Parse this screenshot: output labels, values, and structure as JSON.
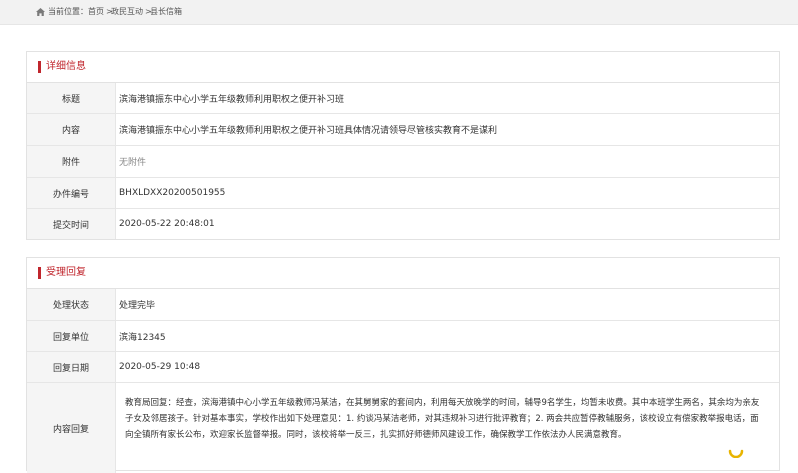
{
  "breadcrumb": {
    "prefix": "当前位置：",
    "items": [
      "首页",
      "政民互动",
      "县长信箱"
    ],
    "separator": ">"
  },
  "details": {
    "title": "详细信息",
    "rows": [
      {
        "label": "标题",
        "value": "滨海港镇振东中心小学五年级教师利用职权之便开补习班"
      },
      {
        "label": "内容",
        "value": "滨海港镇振东中心小学五年级教师利用职权之便开补习班具体情况请领导尽管核实教育不是谋利"
      },
      {
        "label": "附件",
        "value": "无附件"
      },
      {
        "label": "办件编号",
        "value": "BHXLDXX20200501955"
      },
      {
        "label": "提交时间",
        "value": "2020-05-22 20:48:01"
      }
    ]
  },
  "reply": {
    "title": "受理回复",
    "rows": [
      {
        "label": "处理状态",
        "value": "处理完毕"
      },
      {
        "label": "回复单位",
        "value": "滨海12345"
      },
      {
        "label": "回复日期",
        "value": "2020-05-29 10:48"
      },
      {
        "label": "内容回复",
        "value": "教育局回复：经查，滨海港镇中心小学五年级教师冯某洁，在其舅舅家的套间内，利用每天放晚学的时间，辅导9名学生，均暂未收费。其中本班学生两名，其余均为亲友子女及邻居孩子。针对基本事实，学校作出如下处理意见：1. 约谈冯某洁老师，对其违规补习进行批评教育；2. 两会共应暂停教辅服务，该校设立有偿家教举报电话，面向全镇所有家长公布，欢迎家长监督举报。同时，该校将举一反三，扎实抓好师德师风建设工作，确保教学工作依法办人民满意教育。"
      }
    ]
  },
  "colors": {
    "accent": "#c0262d",
    "label_bg": "#f5f5f5",
    "border": "#e2e2e2"
  },
  "icons": {
    "home": "home-icon",
    "loading": "loading-spinner-icon"
  }
}
